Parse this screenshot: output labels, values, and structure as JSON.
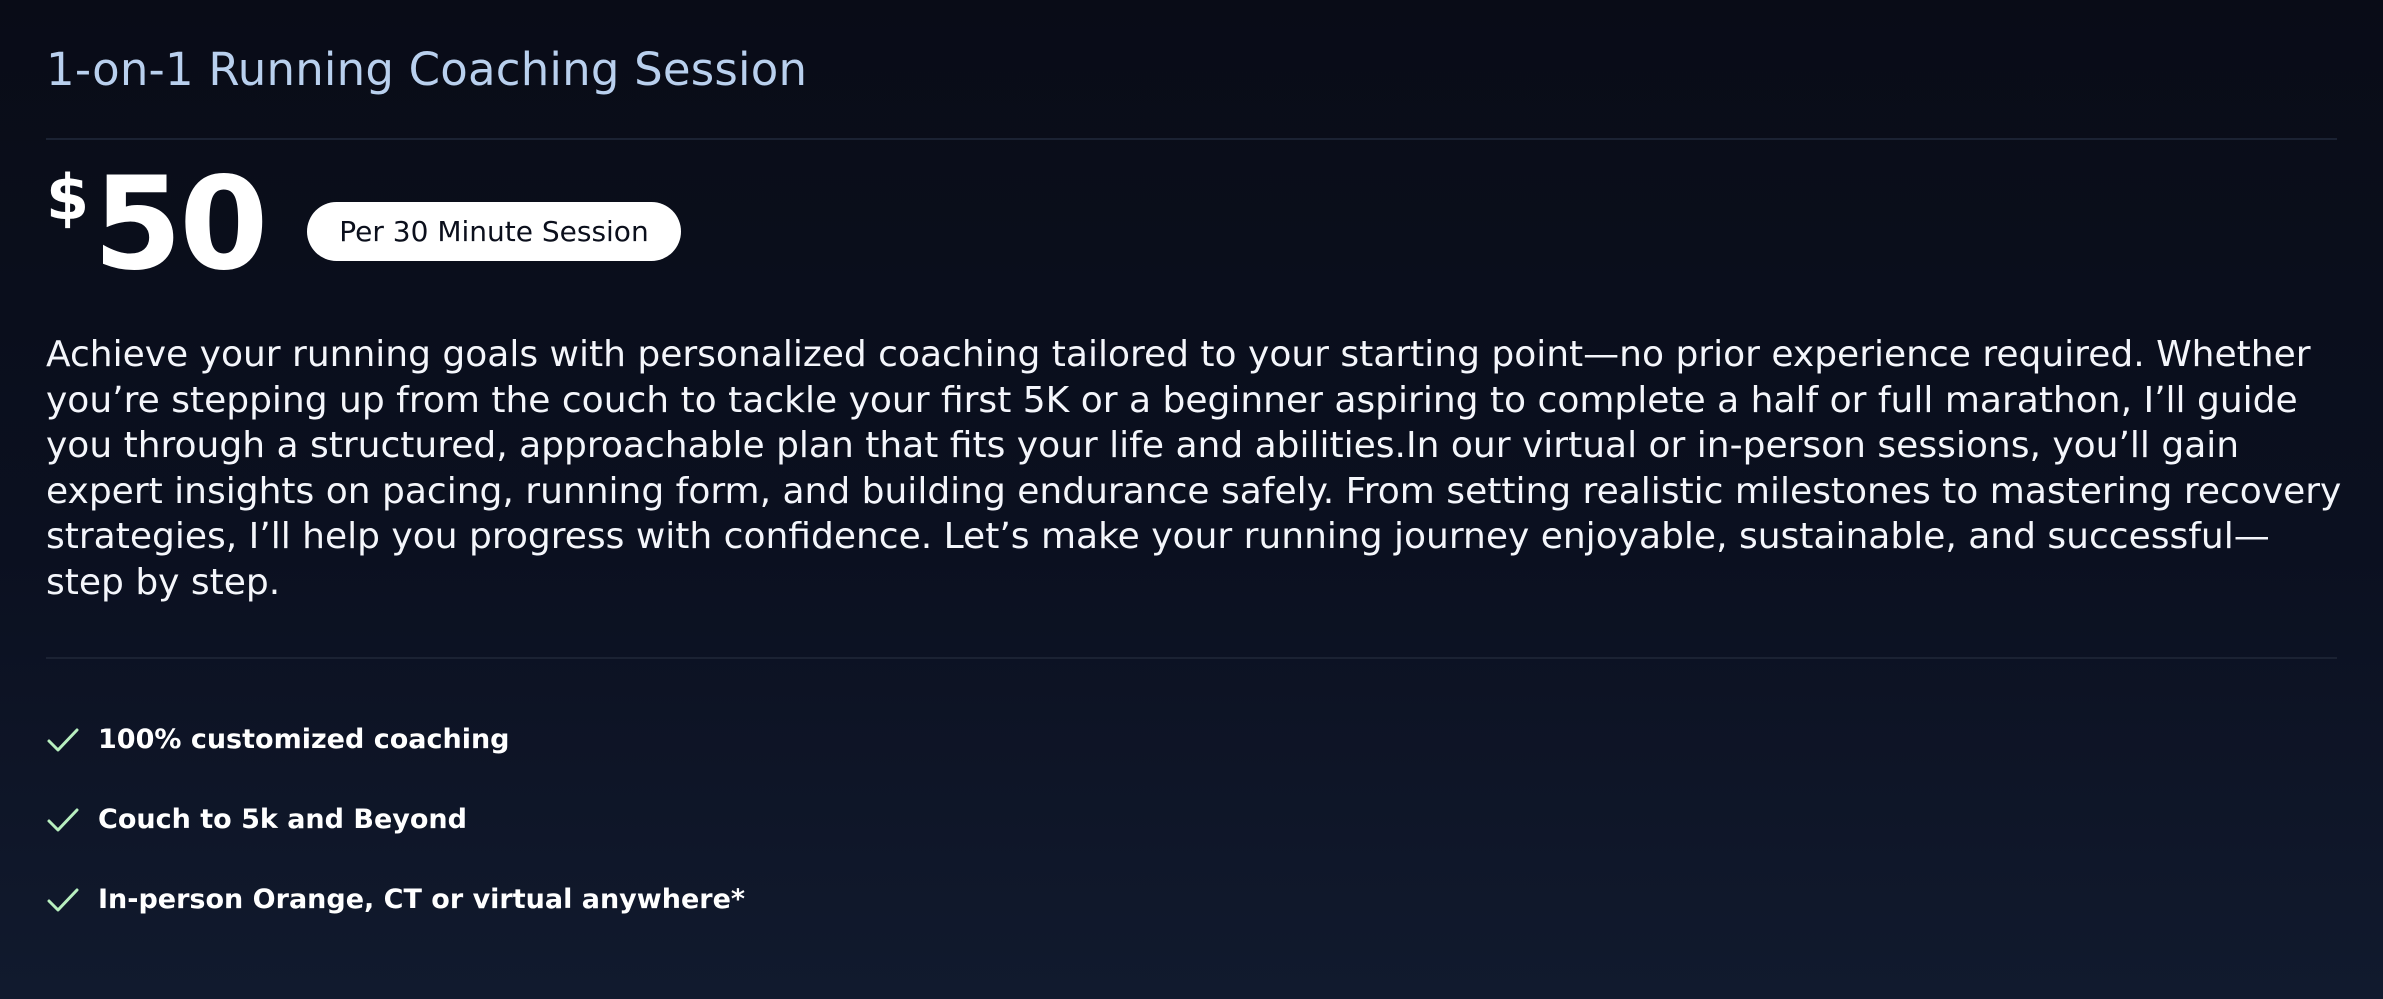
{
  "card": {
    "title": "1-on-1 Running Coaching Session",
    "price": {
      "currency": "$",
      "amount": "50",
      "badge": "Per 30 Minute Session"
    },
    "description": "Achieve your running goals with personalized coaching tailored to your starting point—no prior experience required. Whether you’re stepping up from the couch to tackle your first 5K or a beginner aspiring to complete a half or full marathon, I’ll guide you through a structured, approachable plan that fits your life and abilities.In our virtual or in-person sessions, you’ll gain expert insights on pacing, running form, and building endurance safely. From setting realistic milestones to mastering recovery strategies, I’ll help you progress with confidence. Let’s make your running journey enjoyable, sustainable, and successful—step by step.",
    "features": [
      {
        "label": "100% customized coaching",
        "icon": "check-icon"
      },
      {
        "label": "Couch to 5k and Beyond",
        "icon": "check-icon"
      },
      {
        "label": "In-person Orange, CT or virtual anywhere*",
        "icon": "check-icon"
      }
    ]
  },
  "colors": {
    "background": "#0b1020",
    "title": "#b9d0ee",
    "check": "#b8efbf",
    "badge_bg": "#ffffff",
    "badge_text": "#0b0f1c",
    "divider": "#1b2233"
  }
}
